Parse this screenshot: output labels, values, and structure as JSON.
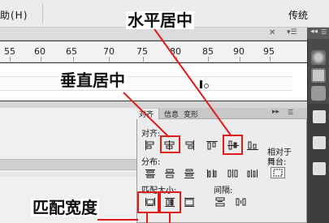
{
  "menubar": {
    "help": "助(H)",
    "mode": "传统"
  },
  "ruler": {
    "ticks": [
      "55",
      "60",
      "65",
      "70",
      "75",
      "80",
      "85",
      "90",
      "95"
    ]
  },
  "align_panel": {
    "tabs": [
      "对齐",
      "信息",
      "变形"
    ],
    "sections": {
      "align": "对齐:",
      "distribute": "分布:",
      "match_size": "匹配大小:",
      "spacing": "间隔:"
    },
    "relative_to_stage": [
      "相对于",
      "舞台:"
    ]
  },
  "annotations": {
    "horizontal_center": "水平居中",
    "vertical_center": "垂直居中",
    "match_width": "匹配宽度"
  },
  "colors": {
    "highlight": "#e01b1b"
  }
}
